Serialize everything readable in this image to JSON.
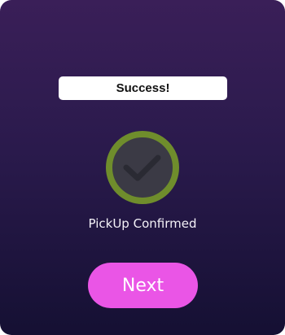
{
  "banner": {
    "text": "Success!"
  },
  "status": {
    "icon": "check-circle-icon",
    "text": "PickUp Confirmed"
  },
  "actions": {
    "next_label": "Next"
  },
  "colors": {
    "background_top": "#3a1f58",
    "background_bottom": "#151033",
    "ring": "#6f8d2c",
    "check": "#3b3a45",
    "button": "#ea55e6"
  }
}
